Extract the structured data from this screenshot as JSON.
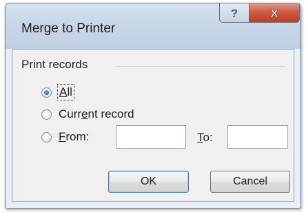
{
  "window": {
    "title": "Merge to Printer",
    "help_glyph": "?",
    "close_glyph": "X"
  },
  "print_records": {
    "group_label": "Print records",
    "options": [
      {
        "label_parts": [
          "",
          "A",
          "ll"
        ],
        "checked": true
      },
      {
        "label_parts": [
          "Curr",
          "e",
          "nt record"
        ],
        "checked": false
      },
      {
        "label_parts": [
          "",
          "F",
          "rom:"
        ],
        "checked": false
      }
    ],
    "from_value": "",
    "to_label_parts": [
      "",
      "T",
      "o:"
    ],
    "to_value": ""
  },
  "buttons": {
    "ok": "OK",
    "cancel": "Cancel"
  },
  "colors": {
    "title_bar": "#c9d8e8",
    "close_button": "#c84f35",
    "radio_selected": "#2a6fc9",
    "default_button_border": "#3c7fb1"
  },
  "icons": {
    "help": "question-mark-icon",
    "close": "close-x-icon"
  }
}
